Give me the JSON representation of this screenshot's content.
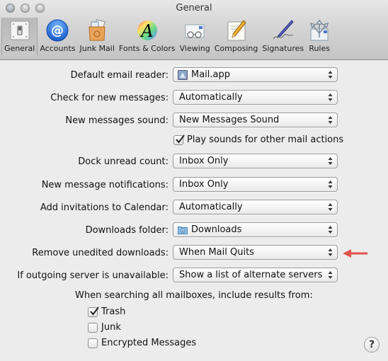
{
  "window": {
    "title": "General"
  },
  "toolbar": {
    "items": [
      {
        "label": "General",
        "icon": "general-switch-icon",
        "selected": true
      },
      {
        "label": "Accounts",
        "icon": "at-sign-icon",
        "selected": false
      },
      {
        "label": "Junk Mail",
        "icon": "junk-mail-bag-icon",
        "selected": false
      },
      {
        "label": "Fonts & Colors",
        "icon": "fonts-colors-icon",
        "selected": false
      },
      {
        "label": "Viewing",
        "icon": "viewing-glasses-icon",
        "selected": false
      },
      {
        "label": "Composing",
        "icon": "composing-pencil-icon",
        "selected": false
      },
      {
        "label": "Signatures",
        "icon": "signature-pen-icon",
        "selected": false
      },
      {
        "label": "Rules",
        "icon": "rules-arrows-icon",
        "selected": false
      }
    ]
  },
  "settings": {
    "default_email_reader": {
      "label": "Default email reader:",
      "value": "Mail.app",
      "icon": "mail-app-icon"
    },
    "check_new_messages": {
      "label": "Check for new messages:",
      "value": "Automatically"
    },
    "new_messages_sound": {
      "label": "New messages sound:",
      "value": "New Messages Sound"
    },
    "play_sounds": {
      "label": "Play sounds for other mail actions",
      "checked": true
    },
    "dock_unread_count": {
      "label": "Dock unread count:",
      "value": "Inbox Only"
    },
    "new_message_notifications": {
      "label": "New message notifications:",
      "value": "Inbox Only"
    },
    "add_invitations": {
      "label": "Add invitations to Calendar:",
      "value": "Automatically"
    },
    "downloads_folder": {
      "label": "Downloads folder:",
      "value": "Downloads",
      "icon": "downloads-folder-icon"
    },
    "remove_unedited_downloads": {
      "label": "Remove unedited downloads:",
      "value": "When Mail Quits"
    },
    "outgoing_server_unavailable": {
      "label": "If outgoing server is unavailable:",
      "value": "Show a list of alternate servers"
    }
  },
  "search": {
    "heading": "When searching all mailboxes, include results from:",
    "options": [
      {
        "label": "Trash",
        "checked": true
      },
      {
        "label": "Junk",
        "checked": false
      },
      {
        "label": "Encrypted Messages",
        "checked": false
      }
    ]
  },
  "help": {
    "label": "?"
  },
  "annotation": {
    "color": "#e0524a",
    "points_to": "remove_unedited_downloads"
  }
}
